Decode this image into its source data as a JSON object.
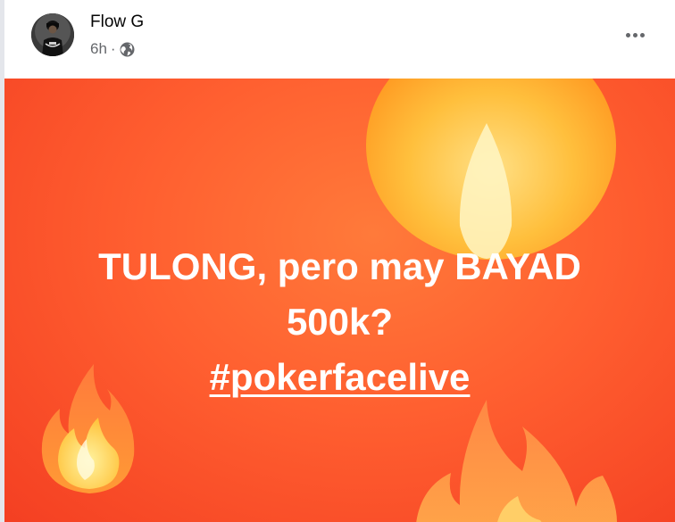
{
  "post": {
    "author": "Flow G",
    "time": "6h",
    "separator": "·",
    "privacy_icon": "globe-icon",
    "more_icon": "more-options-icon"
  },
  "image": {
    "line1": "TULONG, pero may BAYAD",
    "line2": "500k?",
    "hashtag": "#pokerfacelive",
    "background_color": "#ff5f30",
    "text_color": "#ffffff",
    "decorations": [
      "fire-emoji-icon",
      "fire-emoji-icon",
      "fire-emoji-icon"
    ]
  }
}
